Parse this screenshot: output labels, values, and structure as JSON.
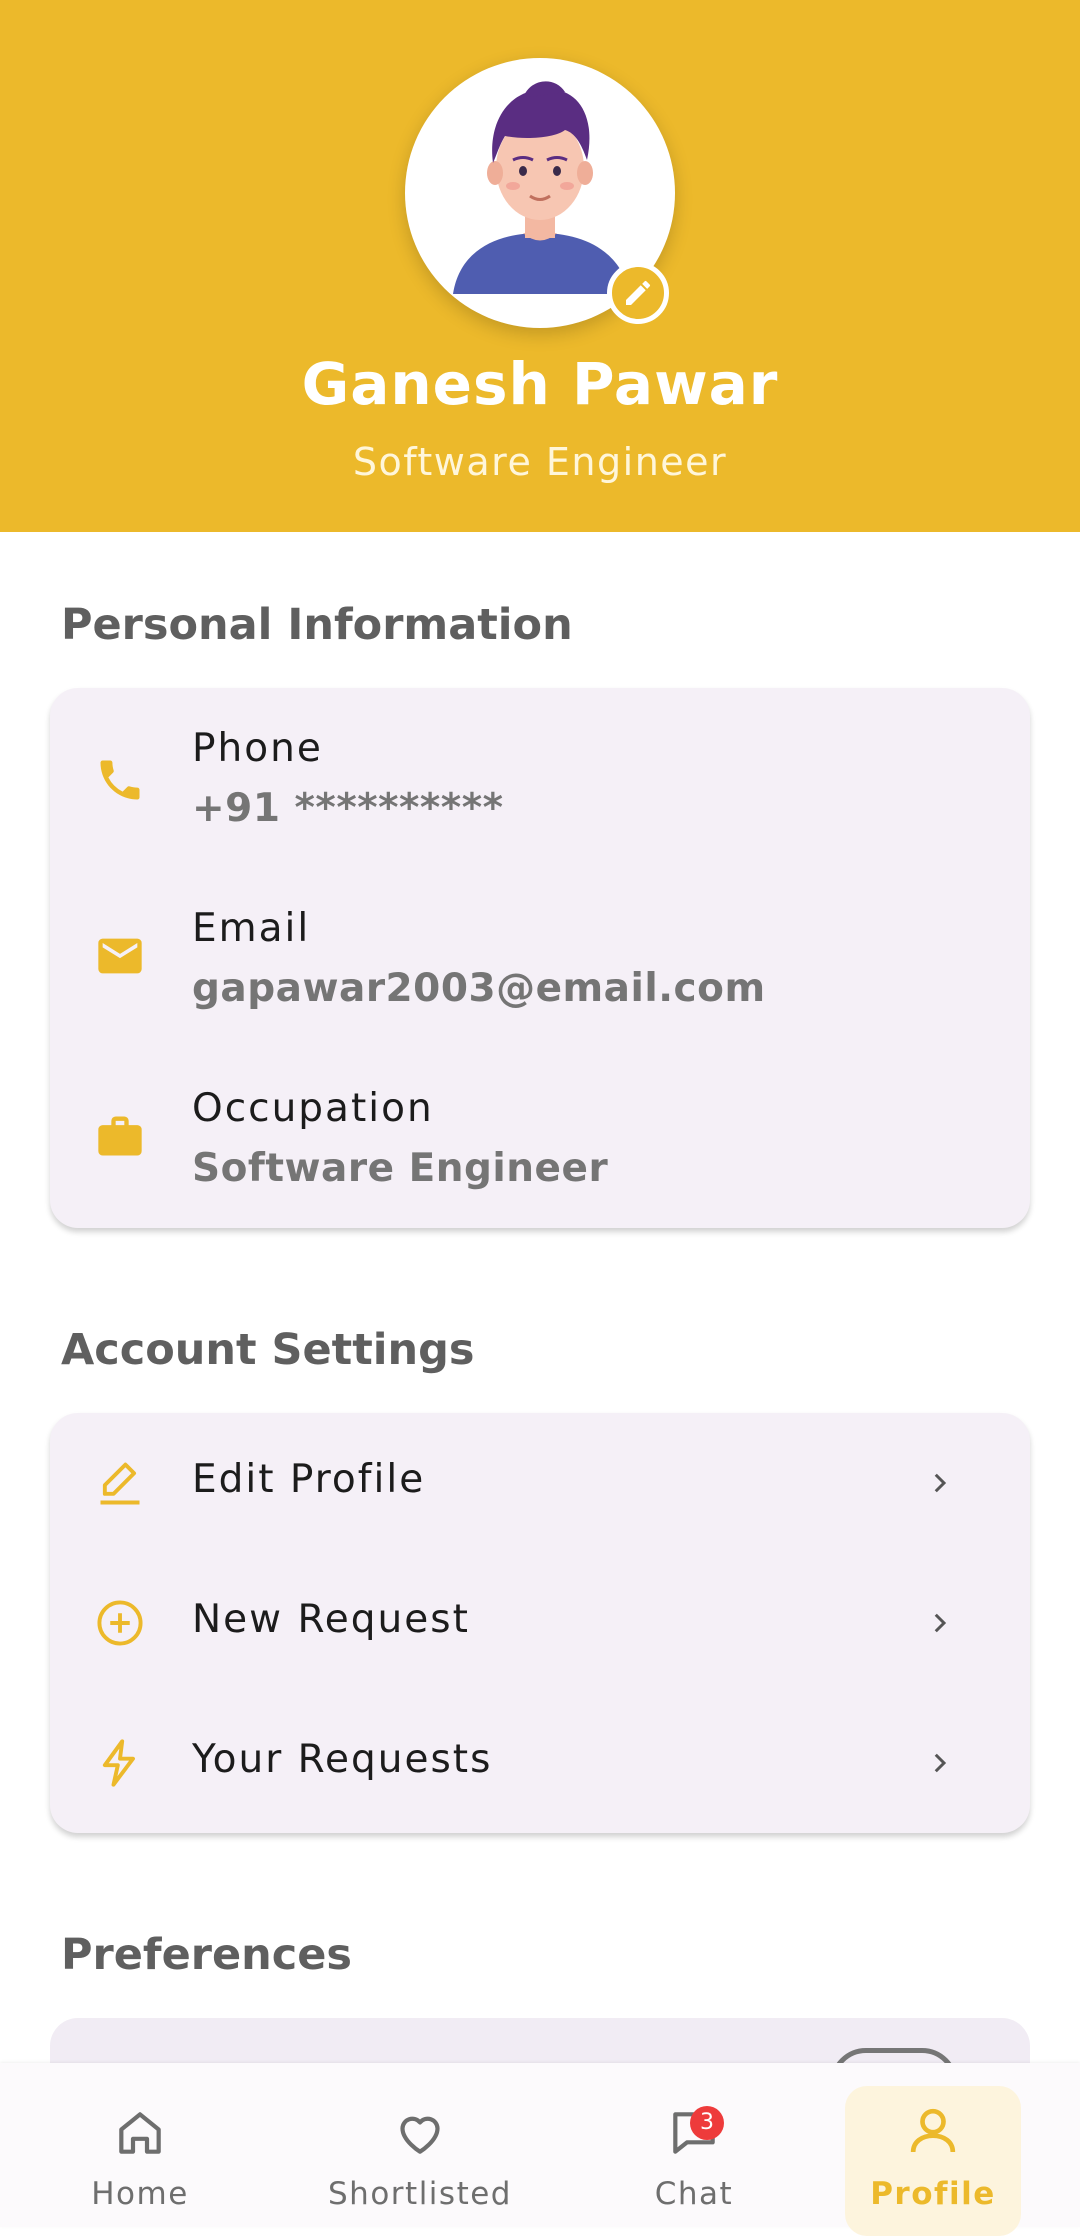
{
  "profile": {
    "name": "Ganesh Pawar",
    "occupation": "Software Engineer"
  },
  "personal": {
    "title": "Personal Information",
    "items": [
      {
        "label": "Phone",
        "value": "+91 **********",
        "icon": "phone-icon"
      },
      {
        "label": "Email",
        "value": "gapawar2003@email.com",
        "icon": "email-icon"
      },
      {
        "label": "Occupation",
        "value": "Software Engineer",
        "icon": "briefcase-icon"
      }
    ]
  },
  "account": {
    "title": "Account Settings",
    "items": [
      {
        "label": "Edit Profile",
        "icon": "edit-icon"
      },
      {
        "label": "New Request",
        "icon": "add-circle-icon"
      },
      {
        "label": "Your Requests",
        "icon": "lightning-icon"
      }
    ]
  },
  "preferences": {
    "title": "Preferences"
  },
  "nav": {
    "items": [
      {
        "label": "Home",
        "icon": "home-icon",
        "active": false
      },
      {
        "label": "Shortlisted",
        "icon": "heart-icon",
        "active": false
      },
      {
        "label": "Chat",
        "icon": "chat-icon",
        "active": false,
        "badge": "3"
      },
      {
        "label": "Profile",
        "icon": "person-icon",
        "active": true
      }
    ]
  },
  "colors": {
    "accent": "#ECB92B",
    "card_bg": "#F5F0F7",
    "badge_red": "#EE3B3B"
  }
}
